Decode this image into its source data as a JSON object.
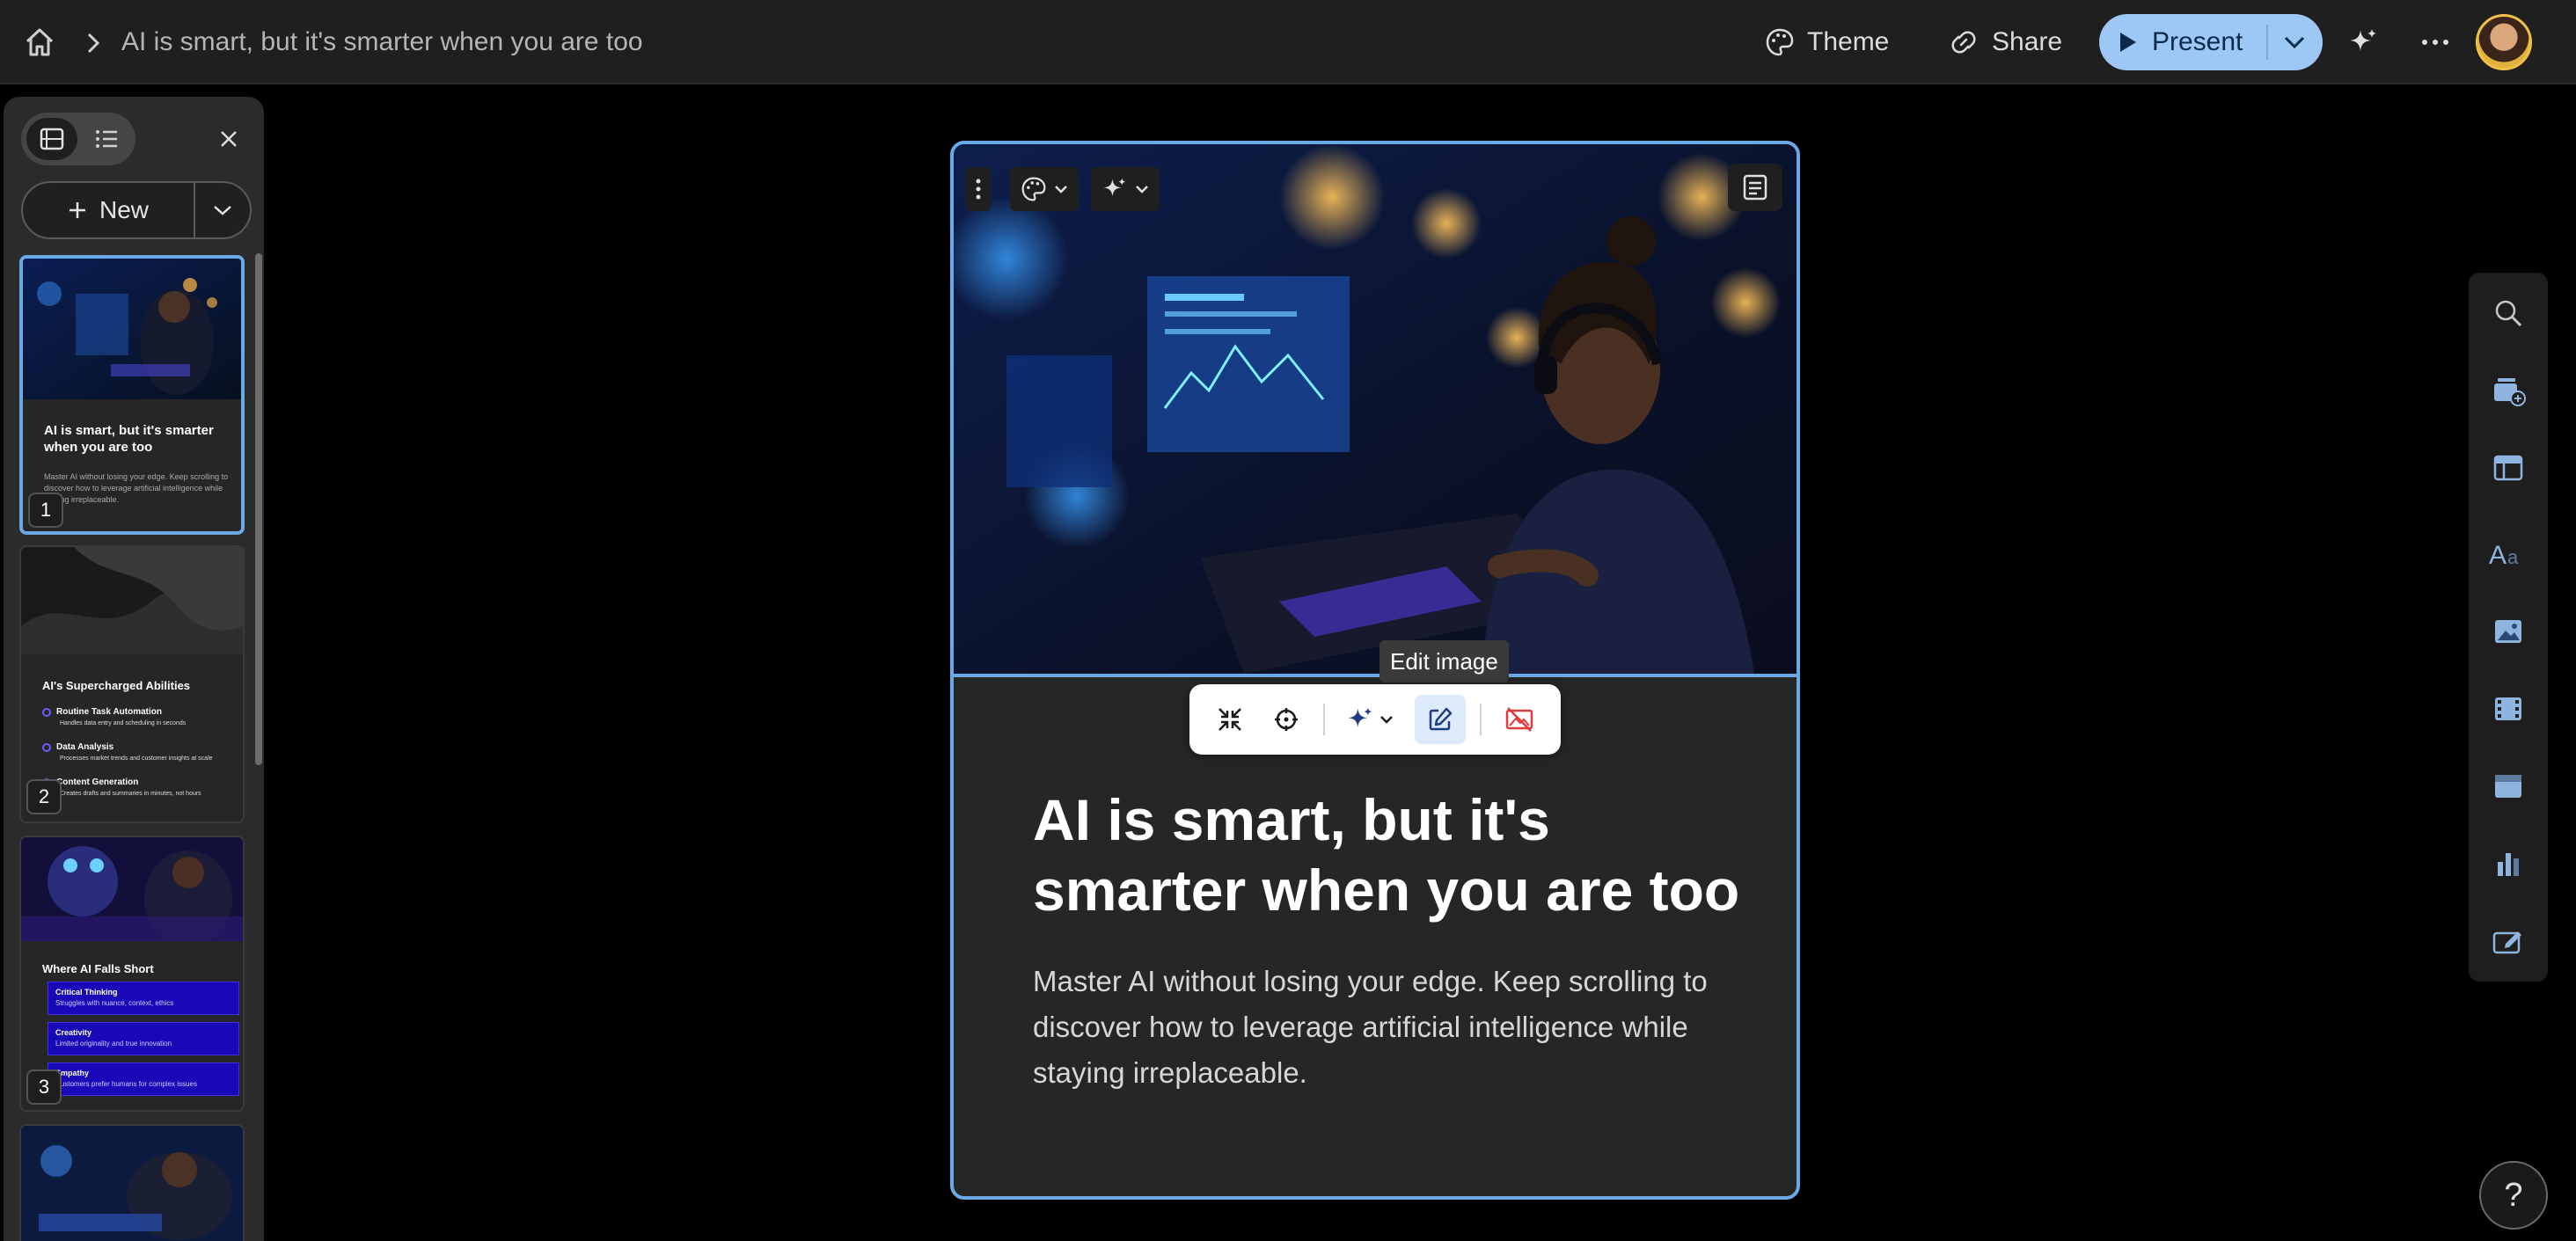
{
  "topbar": {
    "breadcrumb_title": "AI is smart, but it's smarter when you are too",
    "theme_label": "Theme",
    "share_label": "Share",
    "present_label": "Present"
  },
  "panel": {
    "new_label": "New",
    "slides": [
      {
        "number": "1",
        "title": "AI is smart, but it's smarter when you are too",
        "desc": "Master AI without losing your edge. Keep scrolling to discover how to leverage artificial intelligence while staying irreplaceable."
      },
      {
        "number": "2",
        "title": "AI's Supercharged Abilities",
        "features": [
          {
            "name": "Routine Task Automation",
            "desc": "Handles data entry and scheduling in seconds"
          },
          {
            "name": "Data Analysis",
            "desc": "Processes market trends and customer insights at scale"
          },
          {
            "name": "Content Generation",
            "desc": "Creates drafts and summaries in minutes, not hours"
          }
        ]
      },
      {
        "number": "3",
        "title": "Where AI Falls Short",
        "features": [
          {
            "name": "Critical Thinking",
            "desc": "Struggles with nuance, context, ethics"
          },
          {
            "name": "Creativity",
            "desc": "Limited originality and true innovation"
          },
          {
            "name": "Empathy",
            "desc": "Customers prefer humans for complex issues"
          }
        ]
      }
    ]
  },
  "card": {
    "title": "AI is smart, but it's smarter when you are too",
    "description": "Master AI without losing your edge. Keep scrolling to discover how to leverage artificial intelligence while staying irreplaceable."
  },
  "image_toolbar": {
    "tooltip": "Edit image",
    "tools": [
      "collapse-icon",
      "focal-point-icon",
      "ai-sparkle-icon",
      "edit-icon",
      "remove-image-icon"
    ]
  },
  "rail": {
    "items": [
      "search-icon",
      "add-card-icon",
      "layout-icon",
      "text-icon",
      "image-icon",
      "video-icon",
      "embed-icon",
      "chart-icon",
      "edit-form-icon"
    ]
  },
  "help_label": "?",
  "colors": {
    "accent": "#6aa9e6",
    "present_bg": "#9dc8f5",
    "remove_red": "#e03a3a"
  }
}
